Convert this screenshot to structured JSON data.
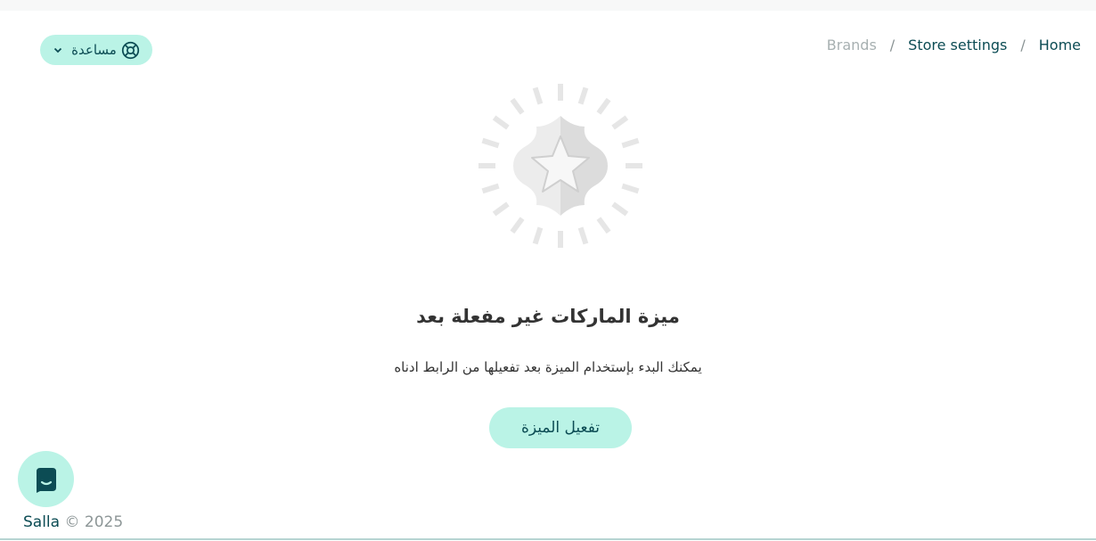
{
  "breadcrumb": {
    "items": [
      {
        "label": "Home"
      },
      {
        "label": "Store settings"
      },
      {
        "label": "Brands"
      }
    ],
    "separator": "/"
  },
  "help": {
    "label": "مساعدة",
    "icon": "lifebuoy-icon"
  },
  "empty_state": {
    "title": "ميزة الماركات غير مفعلة بعد",
    "description": "يمكنك البدء بإستخدام الميزة بعد تفعيلها من الرابط ادناه",
    "button_label": "تفعيل الميزة",
    "illustration_icon": "star-badge-icon"
  },
  "chat": {
    "icon": "chat-icon"
  },
  "footer": {
    "brand": "Salla",
    "copyright": "© 2025"
  },
  "colors": {
    "accent": "#baf3e6",
    "brand_dark": "#0c4c54",
    "muted": "#a7b0b1"
  }
}
